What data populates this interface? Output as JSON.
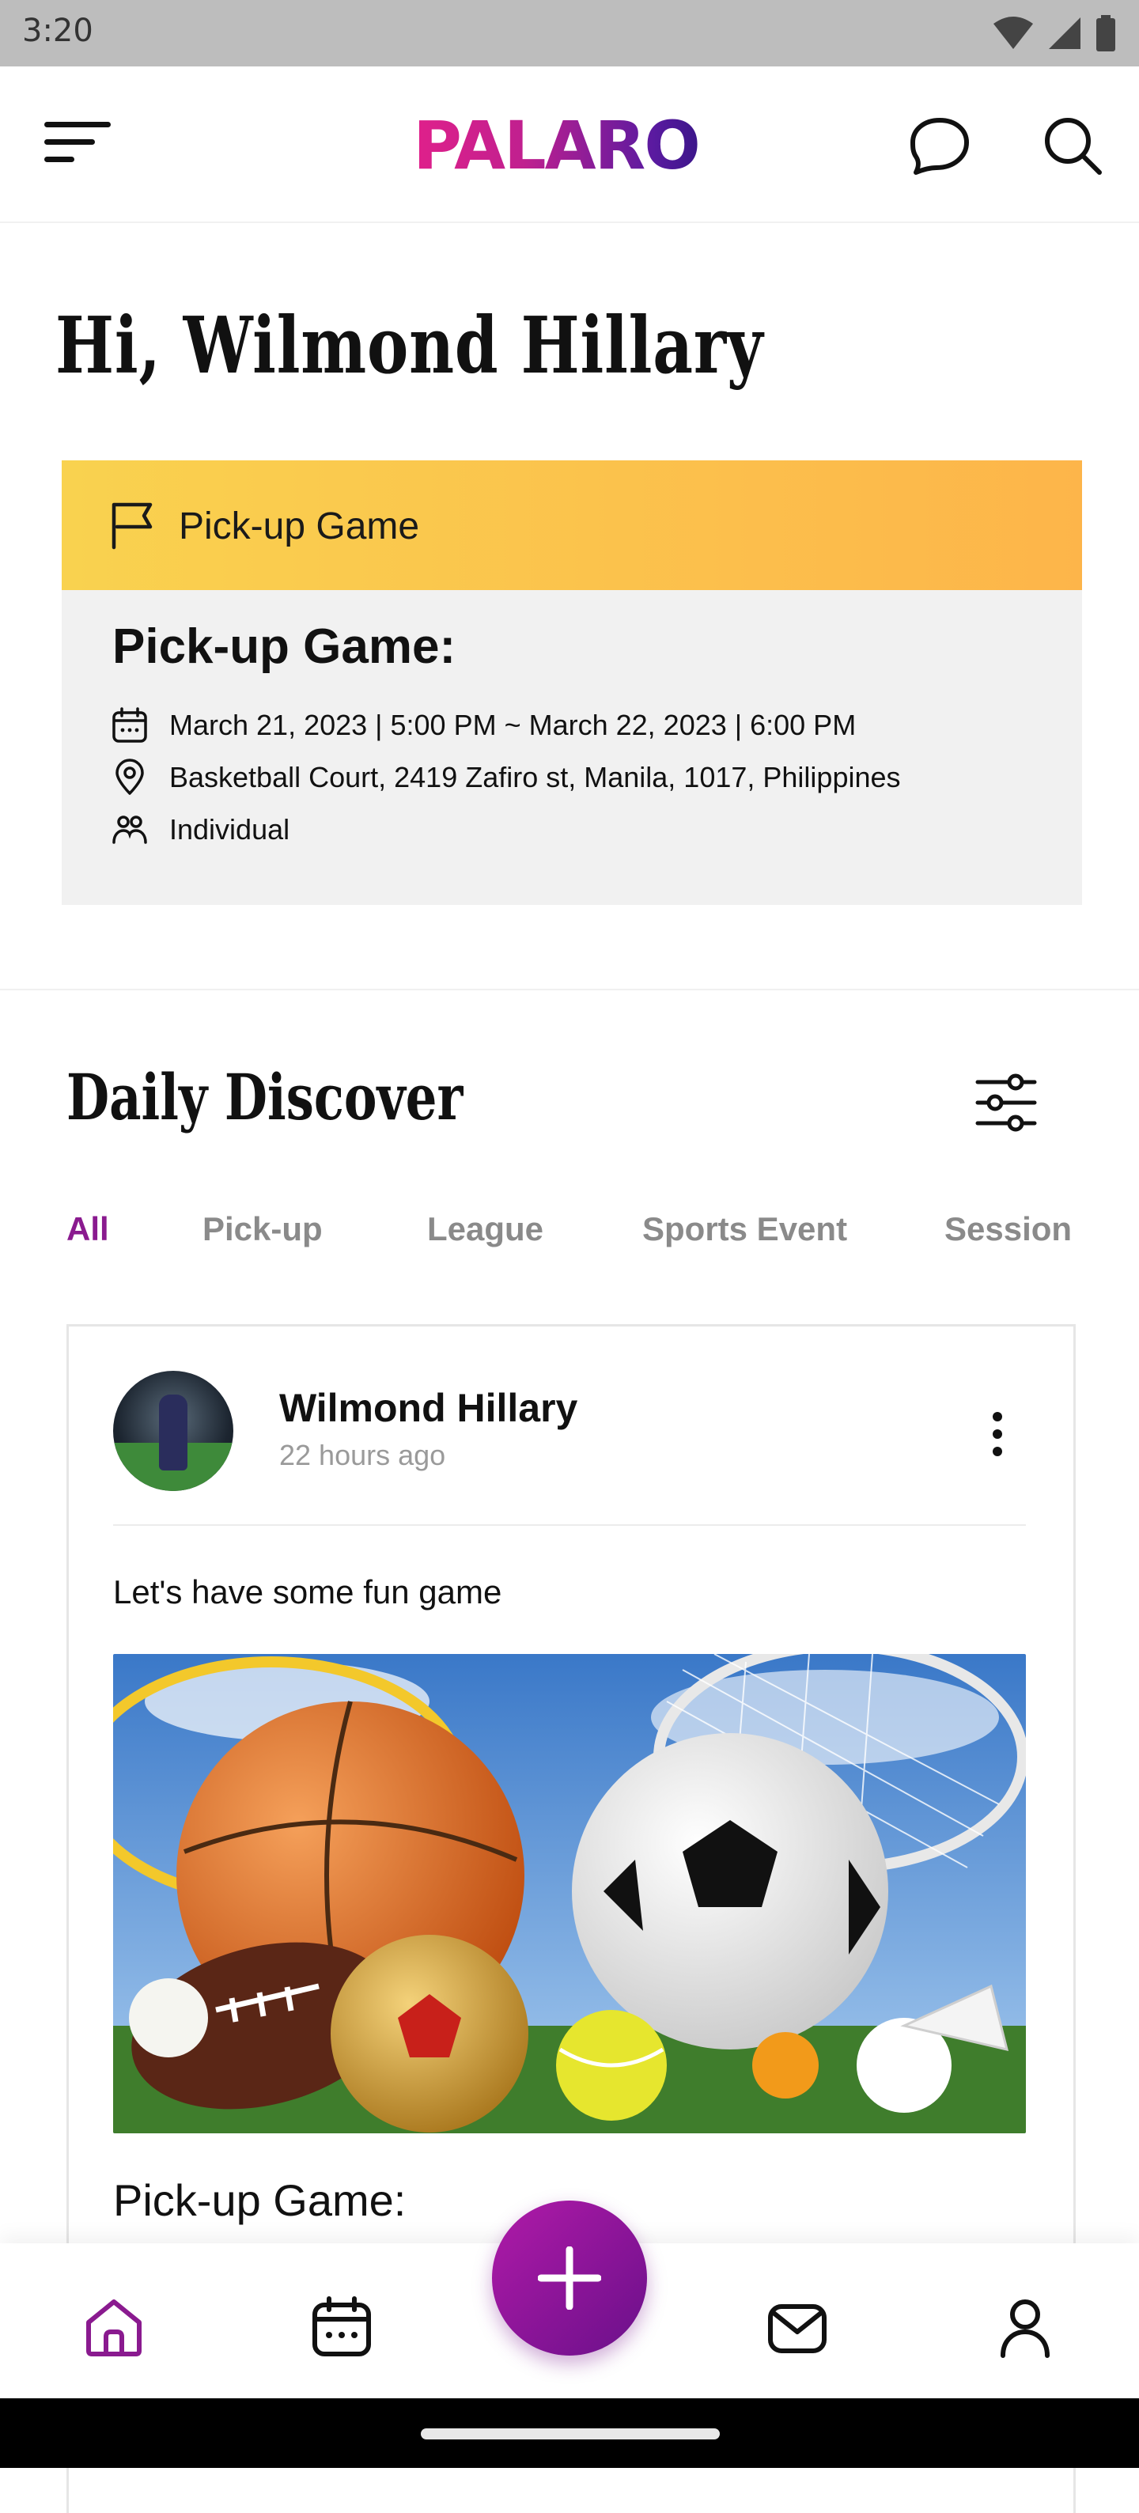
{
  "status_bar": {
    "time": "3:20"
  },
  "header": {
    "brand": "PALARO"
  },
  "greeting": "Hi, Wilmond Hillary",
  "event_card": {
    "banner_label": "Pick-up Game",
    "title": "Pick-up Game:",
    "datetime": "March 21, 2023 | 5:00 PM ~ March 22, 2023 | 6:00 PM",
    "location": "Basketball Court, 2419 Zafiro st, Manila, 1017, Philippines",
    "participation": "Individual"
  },
  "discover": {
    "title": "Daily Discover",
    "tabs": [
      "All",
      "Pick-up",
      "League",
      "Sports Event",
      "Session"
    ],
    "active_tab": "All"
  },
  "post": {
    "author": "Wilmond Hillary",
    "time": "22 hours ago",
    "text": "Let's have some fun game",
    "event_title": "Pick-up Game:"
  },
  "bottom_nav": {
    "items": [
      "home-icon",
      "calendar-icon",
      "add-icon",
      "mail-icon",
      "profile-icon"
    ],
    "active": "home-icon"
  },
  "colors": {
    "accent": "#8a1a8f",
    "banner_start": "#f9d24f",
    "banner_end": "#fdb54a",
    "fab_start": "#b01aa8",
    "fab_end": "#6a108a"
  }
}
